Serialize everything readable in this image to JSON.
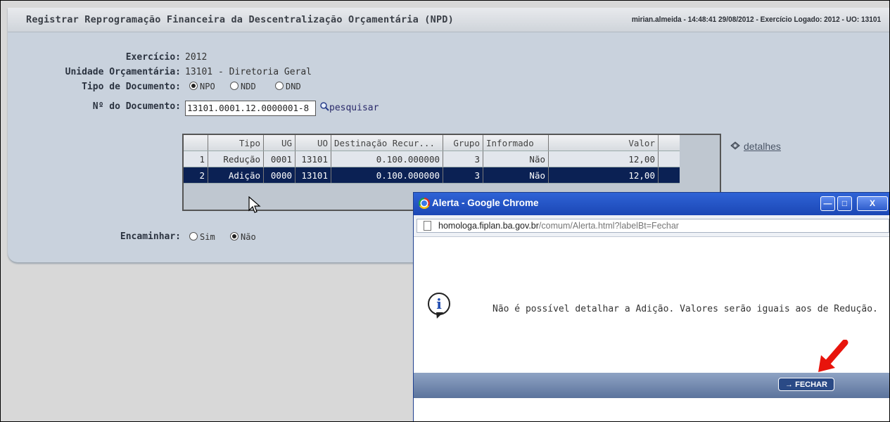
{
  "header": {
    "title": "Registrar Reprogramação Financeira da Descentralização Orçamentária (NPD)",
    "user_info": "mirian.almeida - 14:48:41 29/08/2012 - Exercício Logado: 2012 - UO: 13101"
  },
  "form": {
    "exercicio_label": "Exercício:",
    "exercicio_value": "2012",
    "unidade_label": "Unidade Orçamentária:",
    "unidade_value": "13101 - Diretoria Geral",
    "tipo_label": "Tipo de Documento:",
    "tipo_options": [
      "NPO",
      "NDD",
      "DND"
    ],
    "tipo_selected": "NPO",
    "numero_label": "Nº do Documento:",
    "numero_value": "13101.0001.12.0000001-8",
    "search_label": "pesquisar",
    "encaminhar_label": "Encaminhar:",
    "encaminhar_options": [
      "Sim",
      "Não"
    ],
    "encaminhar_selected": "Não"
  },
  "grid": {
    "columns": [
      "",
      "Tipo",
      "UG",
      "UO",
      "Destinação Recur...",
      "Grupo",
      "Informado",
      "Valor"
    ],
    "rows": [
      [
        "1",
        "Redução",
        "0001",
        "13101",
        "0.100.000000",
        "3",
        "Não",
        "12,00"
      ],
      [
        "2",
        "Adição",
        "0000",
        "13101",
        "0.100.000000",
        "3",
        "Não",
        "12,00"
      ]
    ],
    "selected_row": 2
  },
  "detalhes_label": "detalhes",
  "dialog": {
    "title": "Alerta - Google Chrome",
    "url_host": "homologa.fiplan.ba.gov.br",
    "url_path": "/comum/Alerta.html?labelBt=Fechar",
    "message": "Não é possível detalhar a Adição. Valores serão iguais aos de Redução.",
    "button_label": "→ FECHAR",
    "controls": [
      "minimize-icon",
      "maximize-icon",
      "close-icon"
    ]
  },
  "colors": {
    "selected_row": "#0b2154",
    "dialog_title": "#2356cc",
    "annotation_arrow": "#e8140c"
  }
}
